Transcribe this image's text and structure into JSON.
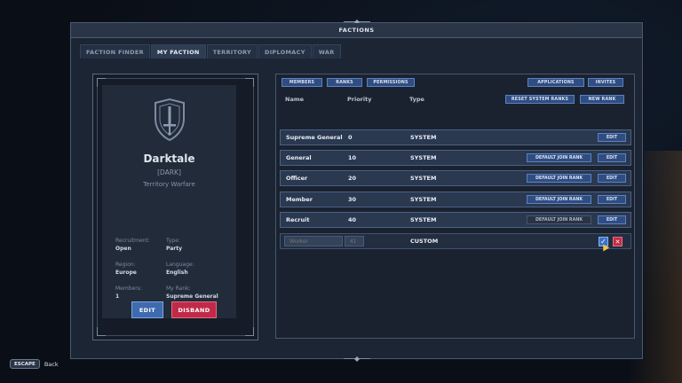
{
  "window": {
    "title": "FACTIONS"
  },
  "tabs": [
    {
      "label": "FACTION FINDER",
      "active": false
    },
    {
      "label": "MY FACTION",
      "active": true
    },
    {
      "label": "TERRITORY",
      "active": false
    },
    {
      "label": "DIPLOMACY",
      "active": false
    },
    {
      "label": "WAR",
      "active": false
    }
  ],
  "faction": {
    "name": "Darktale",
    "tag": "[DARK]",
    "description": "Territory Warfare",
    "emblem_icon": "shield-sword-icon",
    "info": {
      "recruitment_label": "Recruitment:",
      "recruitment_value": "Open",
      "type_label": "Type:",
      "type_value": "Party",
      "region_label": "Region:",
      "region_value": "Europe",
      "language_label": "Language:",
      "language_value": "English",
      "members_label": "Members:",
      "members_value": "1",
      "myrank_label": "My Rank:",
      "myrank_value": "Supreme General"
    },
    "edit_label": "EDIT",
    "disband_label": "DISBAND"
  },
  "ranks_panel": {
    "sub_tabs": {
      "members": "MEMBERS",
      "ranks": "RANKS",
      "permissions": "PERMISSIONS"
    },
    "actions": {
      "applications": "APPLICATIONS",
      "invites": "INVITES",
      "reset": "RESET SYSTEM RANKS",
      "new_rank": "NEW RANK"
    },
    "columns": {
      "name": "Name",
      "priority": "Priority",
      "type": "Type"
    },
    "rows": [
      {
        "name": "Supreme General",
        "priority": "0",
        "type": "SYSTEM",
        "edit": "EDIT"
      },
      {
        "name": "General",
        "priority": "10",
        "type": "SYSTEM",
        "join": "DEFAULT JOIN RANK",
        "edit": "EDIT"
      },
      {
        "name": "Officer",
        "priority": "20",
        "type": "SYSTEM",
        "join": "DEFAULT JOIN RANK",
        "edit": "EDIT"
      },
      {
        "name": "Member",
        "priority": "30",
        "type": "SYSTEM",
        "join": "DEFAULT JOIN RANK",
        "edit": "EDIT"
      },
      {
        "name": "Recruit",
        "priority": "40",
        "type": "SYSTEM",
        "join": "DEFAULT JOIN RANK",
        "edit": "EDIT"
      }
    ],
    "new_row": {
      "name_placeholder": "Worker",
      "priority_placeholder": "41",
      "type": "CUSTOM"
    }
  },
  "footer": {
    "key": "ESCAPE",
    "label": "Back"
  },
  "colors": {
    "accent_blue": "#3e6aae",
    "danger_red": "#c02a48",
    "panel_bg": "#1c2533"
  }
}
